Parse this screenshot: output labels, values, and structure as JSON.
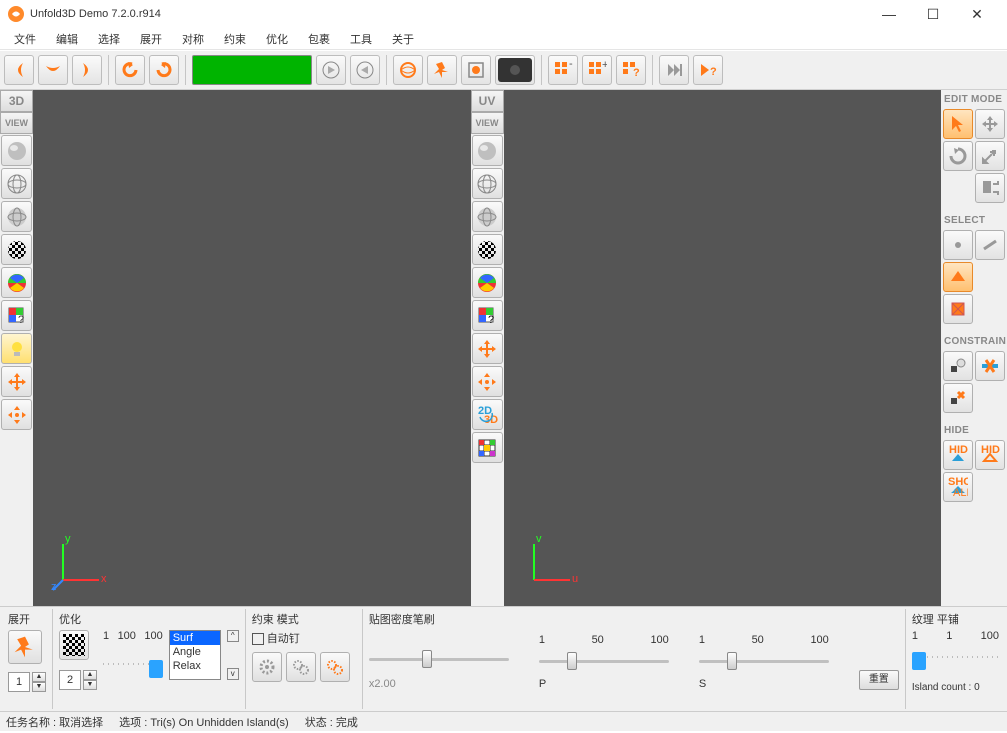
{
  "title": "Unfold3D Demo 7.2.0.r914",
  "menu": [
    "文件",
    "编辑",
    "选择",
    "展开",
    "对称",
    "约束",
    "优化",
    "包裹",
    "工具",
    "关于"
  ],
  "left_view": {
    "badge": "3D",
    "label": "VIEW"
  },
  "right_view": {
    "badge": "UV",
    "label": "VIEW"
  },
  "panels": {
    "edit_mode": "EDIT MODE",
    "select": "SELECT",
    "constrain": "CONSTRAIN",
    "hide": "HIDE"
  },
  "bottom": {
    "unfold": {
      "label": "展开",
      "step": "1"
    },
    "optimize": {
      "label": "优化",
      "step": "2",
      "ticks": [
        "1",
        "100",
        "100"
      ],
      "list": [
        "Surf",
        "Angle",
        "Relax"
      ]
    },
    "constraint": {
      "label": "约束 模式",
      "auto": "自动钉"
    },
    "brush": {
      "label": "贴图密度笔刷",
      "x": "x2.00",
      "p": "P",
      "s": "S",
      "ticks": [
        "1",
        "50",
        "100",
        "1",
        "50",
        "100"
      ],
      "reset": "重置"
    },
    "texture": {
      "label": "纹理 平铺",
      "ticks": [
        "1",
        "1",
        "100"
      ],
      "island": "Island count : 0"
    }
  },
  "status": {
    "task": "任务名称 : 取消选择",
    "opt": "选项 : Tri(s) On Unhidden Island(s)",
    "state": "状态 : 完成"
  }
}
